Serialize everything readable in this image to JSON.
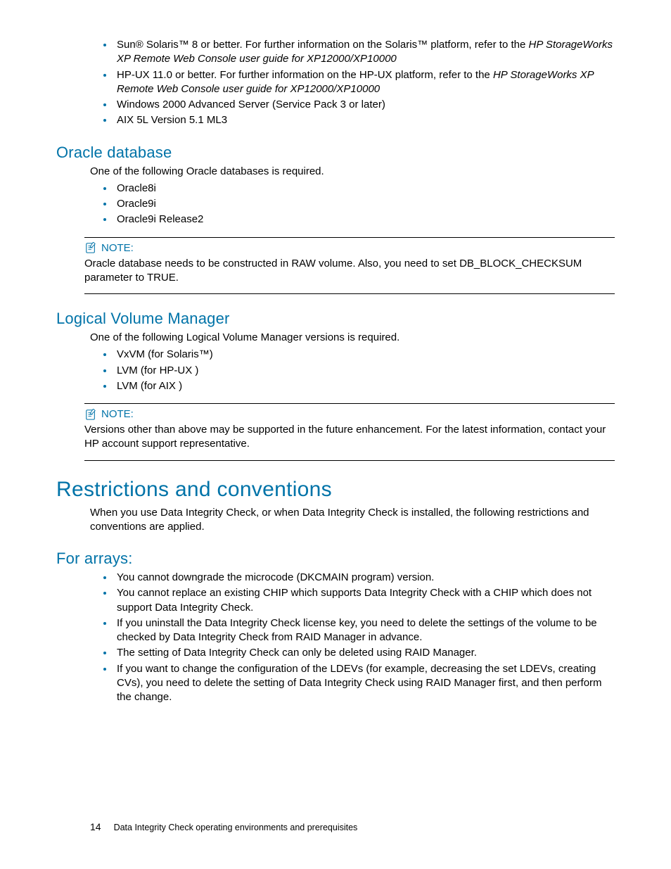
{
  "intro_list": [
    {
      "pre": "Sun® Solaris™ 8 or better.  For further information on the Solaris™ platform, refer to the ",
      "italic": "HP StorageWorks XP Remote Web Console user guide for XP12000/XP10000"
    },
    {
      "pre": "HP-UX 11.0 or better.  For further information on the HP-UX platform, refer to the ",
      "italic": "HP StorageWorks XP Remote Web Console user guide for XP12000/XP10000"
    },
    {
      "pre": "Windows 2000 Advanced Server (Service Pack 3 or later)"
    },
    {
      "pre": "AIX 5L Version 5.1 ML3"
    }
  ],
  "oracle": {
    "heading": "Oracle database",
    "para": "One of the following Oracle databases is required.",
    "items": [
      "Oracle8i",
      "Oracle9i",
      "Oracle9i Release2"
    ],
    "note_label": "NOTE:",
    "note_body": "Oracle database needs to be constructed in RAW volume.  Also, you need to set DB_BLOCK_CHECKSUM parameter to TRUE."
  },
  "lvm": {
    "heading": "Logical Volume Manager",
    "para": "One of the following Logical Volume Manager versions is required.",
    "items": [
      "VxVM (for Solaris™)",
      "LVM (for HP-UX )",
      "LVM (for AIX )"
    ],
    "note_label": "NOTE:",
    "note_body": "Versions other than above may be supported in the future enhancement.  For the latest information, contact your HP account support representative."
  },
  "restrictions": {
    "heading": "Restrictions and conventions",
    "para": "When you use Data Integrity Check, or when Data Integrity Check is installed, the following restrictions and conventions are applied."
  },
  "arrays": {
    "heading": "For arrays:",
    "items": [
      "You cannot downgrade the microcode (DKCMAIN program) version.",
      "You cannot replace an existing CHIP which supports Data Integrity Check with a CHIP which does not support Data Integrity Check.",
      "If you uninstall the Data Integrity Check license key, you need to delete the settings of the volume to be checked by Data Integrity Check from RAID Manager in advance.",
      "The setting of Data Integrity Check can only be deleted using RAID Manager.",
      "If you want to change the configuration of the LDEVs (for example, decreasing the set LDEVs, creating CVs), you need to delete the setting of Data Integrity Check using RAID Manager first, and then perform the change."
    ]
  },
  "footer": {
    "page": "14",
    "text": "Data Integrity Check operating environments and prerequisites"
  }
}
